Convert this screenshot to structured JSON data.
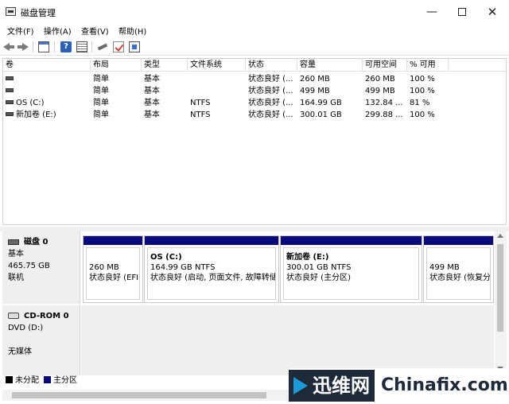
{
  "window": {
    "title": "磁盘管理",
    "minimize": "—",
    "close": "✕"
  },
  "menu": [
    "文件(F)",
    "操作(A)",
    "查看(V)",
    "帮助(H)"
  ],
  "toolbar": {
    "help_label": "?"
  },
  "volume_table": {
    "headers": [
      "卷",
      "布局",
      "类型",
      "文件系统",
      "状态",
      "容量",
      "可用空间",
      "% 可用"
    ],
    "rows": [
      {
        "volume": "",
        "layout": "简单",
        "type": "基本",
        "fs": "",
        "status": "状态良好 (...",
        "capacity": "260 MB",
        "free": "260 MB",
        "pct": "100 %"
      },
      {
        "volume": "",
        "layout": "简单",
        "type": "基本",
        "fs": "",
        "status": "状态良好 (...",
        "capacity": "499 MB",
        "free": "499 MB",
        "pct": "100 %"
      },
      {
        "volume": "OS (C:)",
        "layout": "简单",
        "type": "基本",
        "fs": "NTFS",
        "status": "状态良好 (...",
        "capacity": "164.99 GB",
        "free": "132.84 ...",
        "pct": "81 %"
      },
      {
        "volume": "新加卷 (E:)",
        "layout": "简单",
        "type": "基本",
        "fs": "NTFS",
        "status": "状态良好 (...",
        "capacity": "300.01 GB",
        "free": "299.88 ...",
        "pct": "100 %"
      }
    ]
  },
  "disk0": {
    "name": "磁盘 0",
    "type": "基本",
    "size": "465.75 GB",
    "state": "联机",
    "partitions": [
      {
        "name": "",
        "size": "260 MB",
        "status": "状态良好 (EFI"
      },
      {
        "name": "OS  (C:)",
        "size": "164.99 GB NTFS",
        "status": "状态良好 (启动, 页面文件, 故障转储"
      },
      {
        "name": "新加卷  (E:)",
        "size": "300.01 GB NTFS",
        "status": "状态良好 (主分区)"
      },
      {
        "name": "",
        "size": "499 MB",
        "status": "状态良好 (恢复分"
      }
    ]
  },
  "cdrom0": {
    "name": "CD-ROM 0",
    "drive": "DVD (D:)",
    "media": "无媒体"
  },
  "legend": [
    {
      "label": "未分配",
      "color": "#000000"
    },
    {
      "label": "主分区",
      "color": "#0a0a7a"
    }
  ],
  "watermark": {
    "logo": "迅维网",
    "site": "Chinafix.com"
  }
}
